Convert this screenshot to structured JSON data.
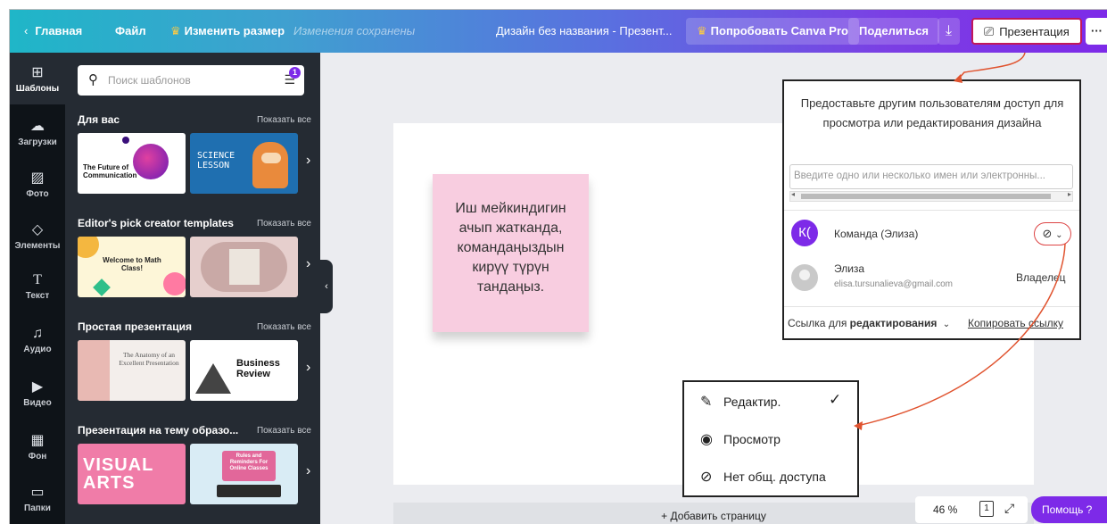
{
  "topbar": {
    "back_label": "Главная",
    "file_label": "Файл",
    "resize_label": "Изменить размер",
    "saved_status": "Изменения сохранены",
    "design_title": "Дизайн без названия - Презент...",
    "try_pro_label": "Попробовать Canva Pro",
    "share_label": "Поделиться",
    "present_label": "Презентация",
    "more_label": "···"
  },
  "rail": [
    {
      "label": "Шаблоны",
      "icon": "⊞"
    },
    {
      "label": "Загрузки",
      "icon": "☁"
    },
    {
      "label": "Фото",
      "icon": "▨"
    },
    {
      "label": "Элементы",
      "icon": "◇"
    },
    {
      "label": "Текст",
      "icon": "T"
    },
    {
      "label": "Аудио",
      "icon": "♫"
    },
    {
      "label": "Видео",
      "icon": "▶"
    },
    {
      "label": "Фон",
      "icon": "▦"
    },
    {
      "label": "Папки",
      "icon": "▭"
    }
  ],
  "panel": {
    "search_placeholder": "Поиск шаблонов",
    "filter_badge": "1",
    "show_all": "Показать все",
    "sections": [
      {
        "title": "Для вас",
        "thumbs": [
          {
            "text": "The Future of Communication"
          },
          {
            "text": "SCIENCE LESSON"
          }
        ]
      },
      {
        "title": "Editor's pick creator templates",
        "thumbs": [
          {
            "text": "Welcome to Math Class!"
          },
          {
            "text": ""
          }
        ]
      },
      {
        "title": "Простая презентация",
        "thumbs": [
          {
            "text": "The Anatomy of an Excellent Presentation"
          },
          {
            "text": "Business Review"
          }
        ]
      },
      {
        "title": "Презентация на тему образо...",
        "thumbs": [
          {
            "text": "VISUAL ARTS"
          },
          {
            "text": "Rules and Reminders For Online Classes"
          }
        ]
      }
    ]
  },
  "canvas": {
    "sticky_lines": [
      "Иш мейкиндигин",
      "ачып жатканда,",
      "командаңыздын",
      "кирүү түрүн",
      "тандаңыз."
    ],
    "add_page_label": "+ Добавить страницу",
    "zoom": "46 %",
    "help_label": "Помощь ?"
  },
  "share_popup": {
    "description": "Предоставьте другим пользователям доступ для просмотра или редактирования дизайна",
    "input_placeholder": "Введите одно или несколько имен или электронны...",
    "team_initial": "К(",
    "team_name": "Команда (Элиза)",
    "user_name": "Элиза",
    "user_email": "elisa.tursunalieva@gmail.com",
    "user_role": "Владелец",
    "link_prefix": "Ссылка для",
    "link_mode": "редактирования",
    "copy_link": "Копировать ссылку"
  },
  "permissions_menu": {
    "options": [
      {
        "label": "Редактир.",
        "icon": "pencil-icon"
      },
      {
        "label": "Просмотр",
        "icon": "eye-icon"
      },
      {
        "label": "Нет общ. доступа",
        "icon": "eye-off-icon"
      }
    ],
    "selected": "Редактир."
  },
  "colors": {
    "accent": "#7d2ae8",
    "annotation": "#e0532f"
  }
}
